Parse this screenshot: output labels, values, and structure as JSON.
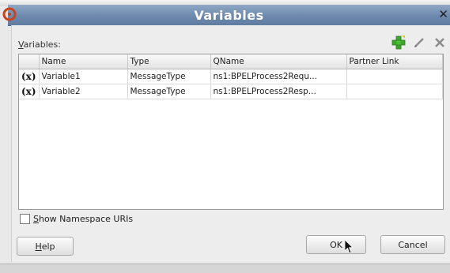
{
  "window": {
    "title": "Variables"
  },
  "dialog": {
    "variables_label_accel": "V",
    "variables_label_rest": "ariables:",
    "columns": [
      "",
      "Name",
      "Type",
      "QName",
      "Partner Link"
    ],
    "rows": [
      {
        "icon": "(x)",
        "name": "Variable1",
        "type": "MessageType",
        "qname": "ns1:BPELProcess2Requ...",
        "partner_link": ""
      },
      {
        "icon": "(x)",
        "name": "Variable2",
        "type": "MessageType",
        "qname": "ns1:BPELProcess2Resp...",
        "partner_link": ""
      }
    ],
    "show_namespace": {
      "accel": "S",
      "rest": "how Namespace URIs",
      "checked": false
    },
    "buttons": {
      "help_accel": "H",
      "help_rest": "elp",
      "ok": "OK",
      "cancel": "Cancel"
    }
  },
  "icons": {
    "add": "add-icon",
    "edit": "pencil-icon",
    "delete": "delete-icon"
  },
  "colors": {
    "titlebar": "#6d89ad",
    "add_green": "#3da52a"
  }
}
